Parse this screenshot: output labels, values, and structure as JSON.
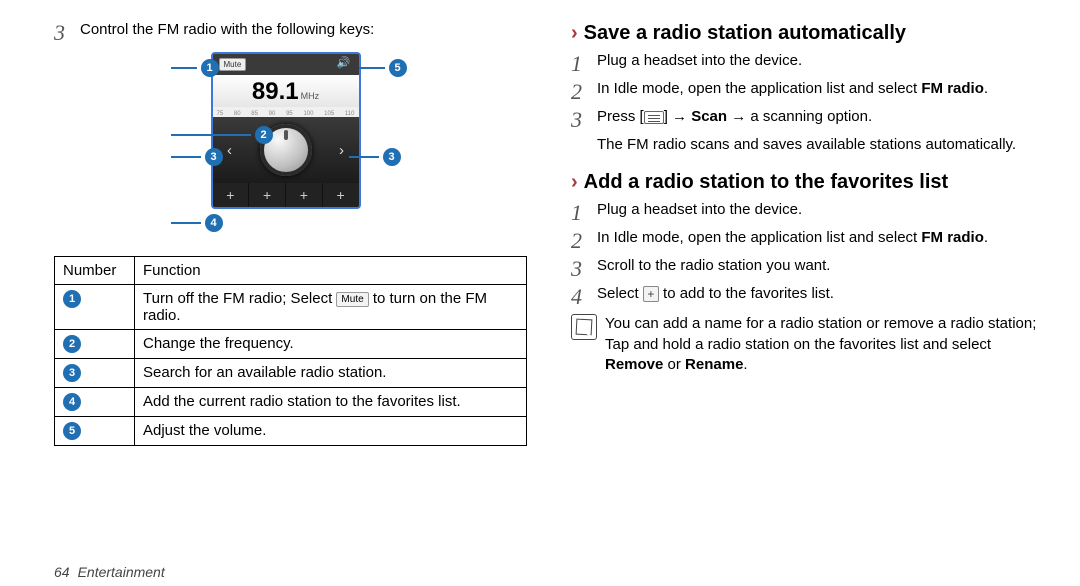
{
  "left": {
    "intro_num": "3",
    "intro_text": "Control the FM radio with the following keys:",
    "radio": {
      "mute_label": "Mute",
      "freq_value": "89.1",
      "freq_unit": "MHz",
      "scale": [
        "75",
        "80",
        "85",
        "90",
        "95",
        "100",
        "105",
        "110"
      ],
      "seek_prev": "‹",
      "seek_next": "›",
      "preset_glyph": "+"
    },
    "callout_badges": {
      "b1": "1",
      "b2": "2",
      "b3l": "3",
      "b3r": "3",
      "b4": "4",
      "b5": "5"
    },
    "table": {
      "headers": {
        "number": "Number",
        "function": "Function"
      },
      "rows": [
        {
          "badge": "1",
          "func_pre": "Turn off the FM radio; Select ",
          "mute_chip": "Mute",
          "func_post": " to turn on the FM radio."
        },
        {
          "badge": "2",
          "func": "Change the frequency."
        },
        {
          "badge": "3",
          "func": "Search for an available radio station."
        },
        {
          "badge": "4",
          "func": "Add the current radio station to the favorites list."
        },
        {
          "badge": "5",
          "func": "Adjust the volume."
        }
      ]
    }
  },
  "right": {
    "sec1": {
      "title": "Save a radio station automatically",
      "steps": [
        {
          "n": "1",
          "text": "Plug a headset into the device."
        },
        {
          "n": "2",
          "pre": "In Idle mode, open the application list and select ",
          "b1": "FM radio",
          "post": "."
        },
        {
          "n": "3",
          "pre": "Press [",
          "mid1": "] → ",
          "b1": "Scan",
          "mid2": " → a scanning option.",
          "sub": "The FM radio scans and saves available stations automatically."
        }
      ]
    },
    "sec2": {
      "title": "Add a radio station to the favorites list",
      "steps": [
        {
          "n": "1",
          "text": "Plug a headset into the device."
        },
        {
          "n": "2",
          "pre": "In Idle mode, open the application list and select ",
          "b1": "FM radio",
          "post": "."
        },
        {
          "n": "3",
          "text": "Scroll to the radio station you want."
        },
        {
          "n": "4",
          "pre": "Select ",
          "post": " to add to the favorites list."
        }
      ],
      "note": "You can add a name for a radio station or remove a radio station; Tap and hold a radio station on the favorites list and select ",
      "note_b1": "Remove",
      "note_mid": " or ",
      "note_b2": "Rename",
      "note_post": "."
    }
  },
  "footer": {
    "page": "64",
    "section": "Entertainment"
  }
}
